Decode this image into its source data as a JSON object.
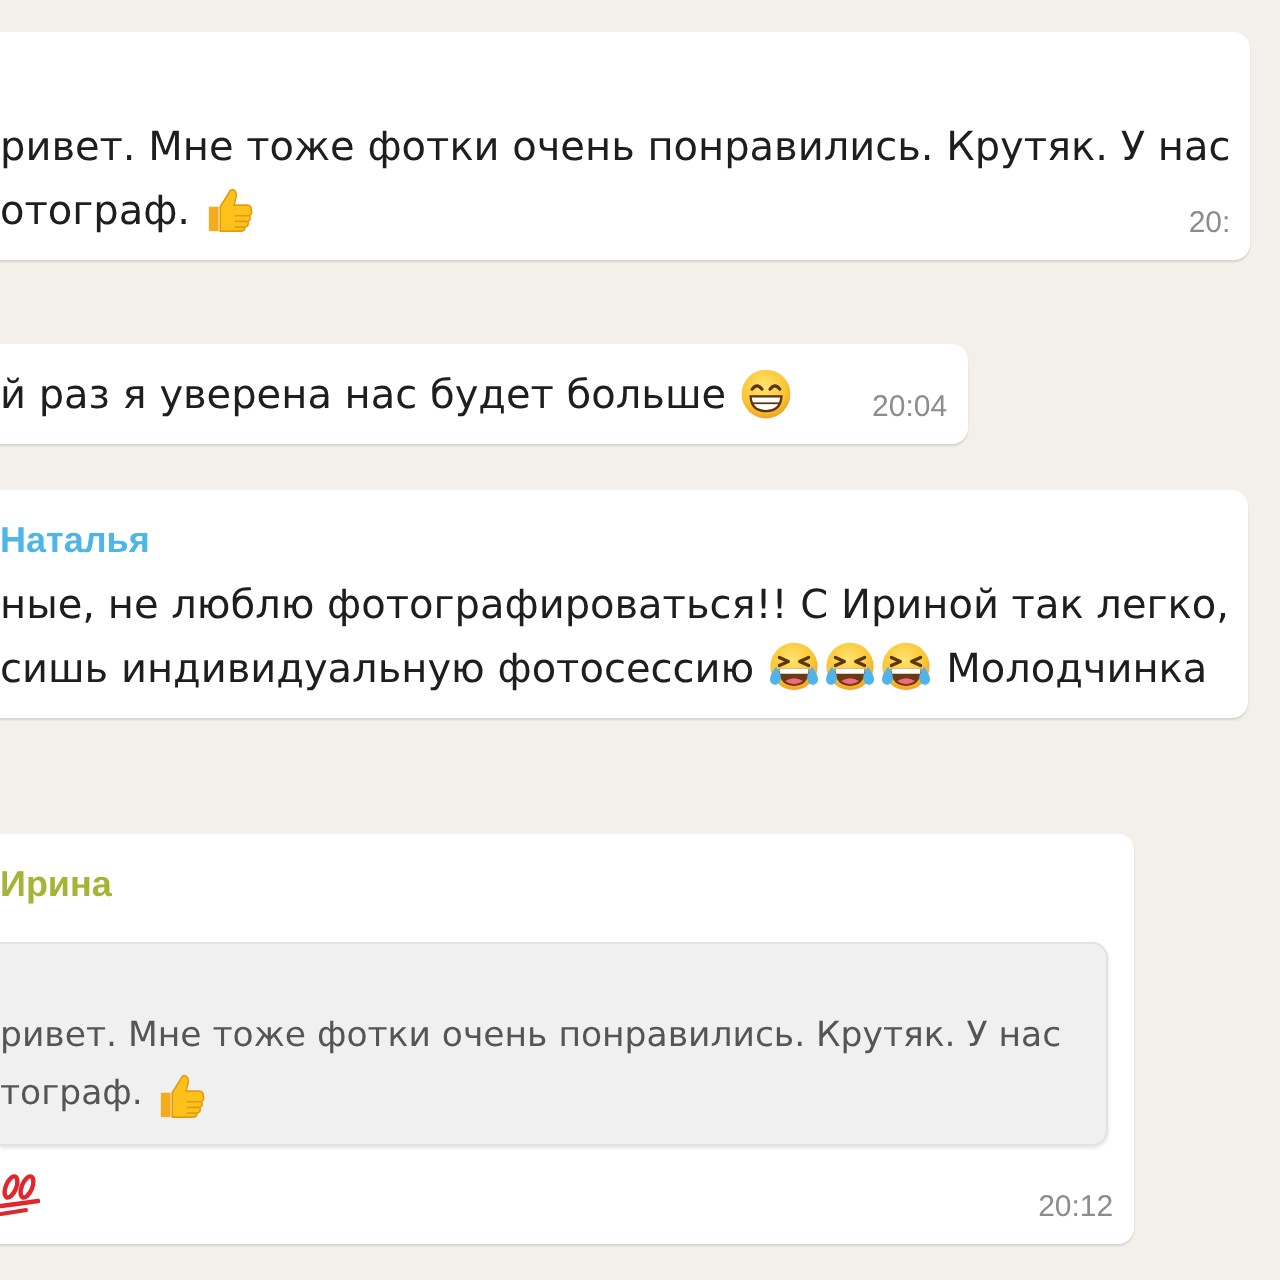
{
  "messages": [
    {
      "kind": "group_start",
      "lines": [
        [
          {
            "kind": "text",
            "text": "ривет. Мне тоже фотки очень понравились. Крутяк. У нас"
          }
        ],
        [
          {
            "kind": "text",
            "text": "отограф."
          },
          {
            "kind": "thumbs_up"
          }
        ]
      ],
      "time": "20:"
    },
    {
      "kind": "continuation",
      "lines": [
        [
          {
            "kind": "text",
            "text": "й раз я уверена нас будет больше"
          },
          {
            "kind": "beaming_face"
          }
        ]
      ],
      "time": "20:04"
    },
    {
      "kind": "group_start",
      "sender": {
        "name": "Наталья",
        "color": "#4db6e6"
      },
      "lines": [
        [
          {
            "kind": "text",
            "text": "ные, не люблю фотографироваться!! С Ириной так легко,"
          }
        ],
        [
          {
            "kind": "text",
            "text": "сишь индивидуальную фотосессию"
          },
          {
            "kind": "tears_of_joy"
          },
          {
            "kind": "tears_of_joy"
          },
          {
            "kind": "tears_of_joy"
          },
          {
            "kind": "text",
            "text": "Молодчинка"
          }
        ]
      ]
    },
    {
      "kind": "group_start",
      "sender": {
        "name": "Ирина",
        "color": "#a5b337"
      },
      "quote": {
        "lines": [
          [
            {
              "kind": "text",
              "text": "ривет. Мне тоже фотки очень понравились. Крутяк. У нас"
            }
          ],
          [
            {
              "kind": "text",
              "text": "тограф."
            },
            {
              "kind": "thumbs_up"
            }
          ]
        ]
      },
      "lines": [
        [
          {
            "kind": "hundred_points"
          }
        ]
      ],
      "time": "20:12"
    }
  ]
}
